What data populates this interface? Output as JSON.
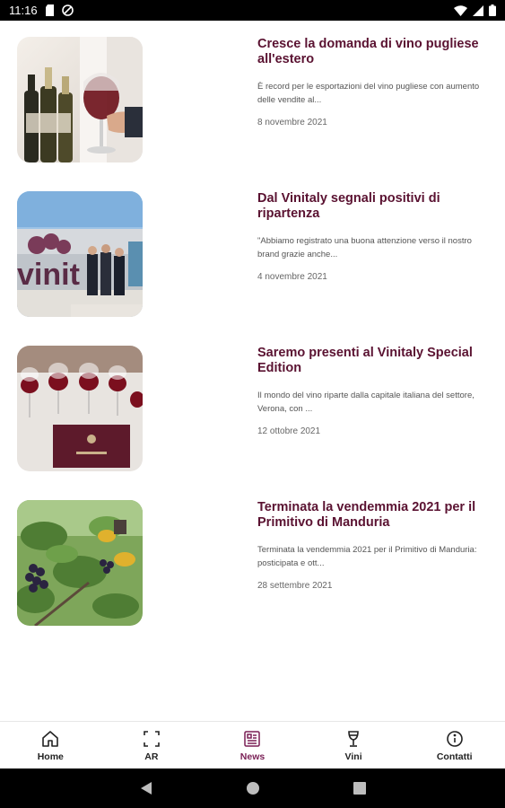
{
  "status_bar": {
    "time": "11:16",
    "left_icons": [
      "sd-card-icon",
      "no-disturb-icon"
    ],
    "right_icons": [
      "wifi-icon",
      "signal-icon",
      "battery-icon"
    ]
  },
  "news": [
    {
      "title": "Cresce la domanda di vino pugliese all'estero",
      "excerpt": "È record per le esportazioni del vino pugliese con aumento delle vendite al...",
      "date": "8 novembre 2021",
      "image": "wine-glass-bottles-photo"
    },
    {
      "title": "Dal Vinitaly segnali positivi di ripartenza",
      "excerpt": "\"Abbiamo registrato una buona attenzione verso il nostro brand grazie anche...",
      "date": "4 novembre 2021",
      "image": "vinitaly-stand-photo"
    },
    {
      "title": "Saremo presenti al Vinitaly Special Edition",
      "excerpt": "Il mondo del vino riparte dalla capitale italiana del settore, Verona, con ...",
      "date": "12 ottobre 2021",
      "image": "wine-glasses-table-photo"
    },
    {
      "title": "Terminata la vendemmia 2021 per il Primitivo di Manduria",
      "excerpt": "Terminata la vendemmia 2021 per il Primitivo di Manduria: posticipata e ott...",
      "date": "28 settembre 2021",
      "image": "grape-harvest-photo"
    }
  ],
  "bottom_nav": {
    "active": "News",
    "items": [
      {
        "label": "Home",
        "icon": "home-icon"
      },
      {
        "label": "AR",
        "icon": "ar-scan-icon"
      },
      {
        "label": "News",
        "icon": "news-icon"
      },
      {
        "label": "Vini",
        "icon": "wine-glass-icon"
      },
      {
        "label": "Contatti",
        "icon": "info-icon"
      }
    ]
  },
  "colors": {
    "accent": "#7a1f55",
    "title": "#5a1231"
  }
}
